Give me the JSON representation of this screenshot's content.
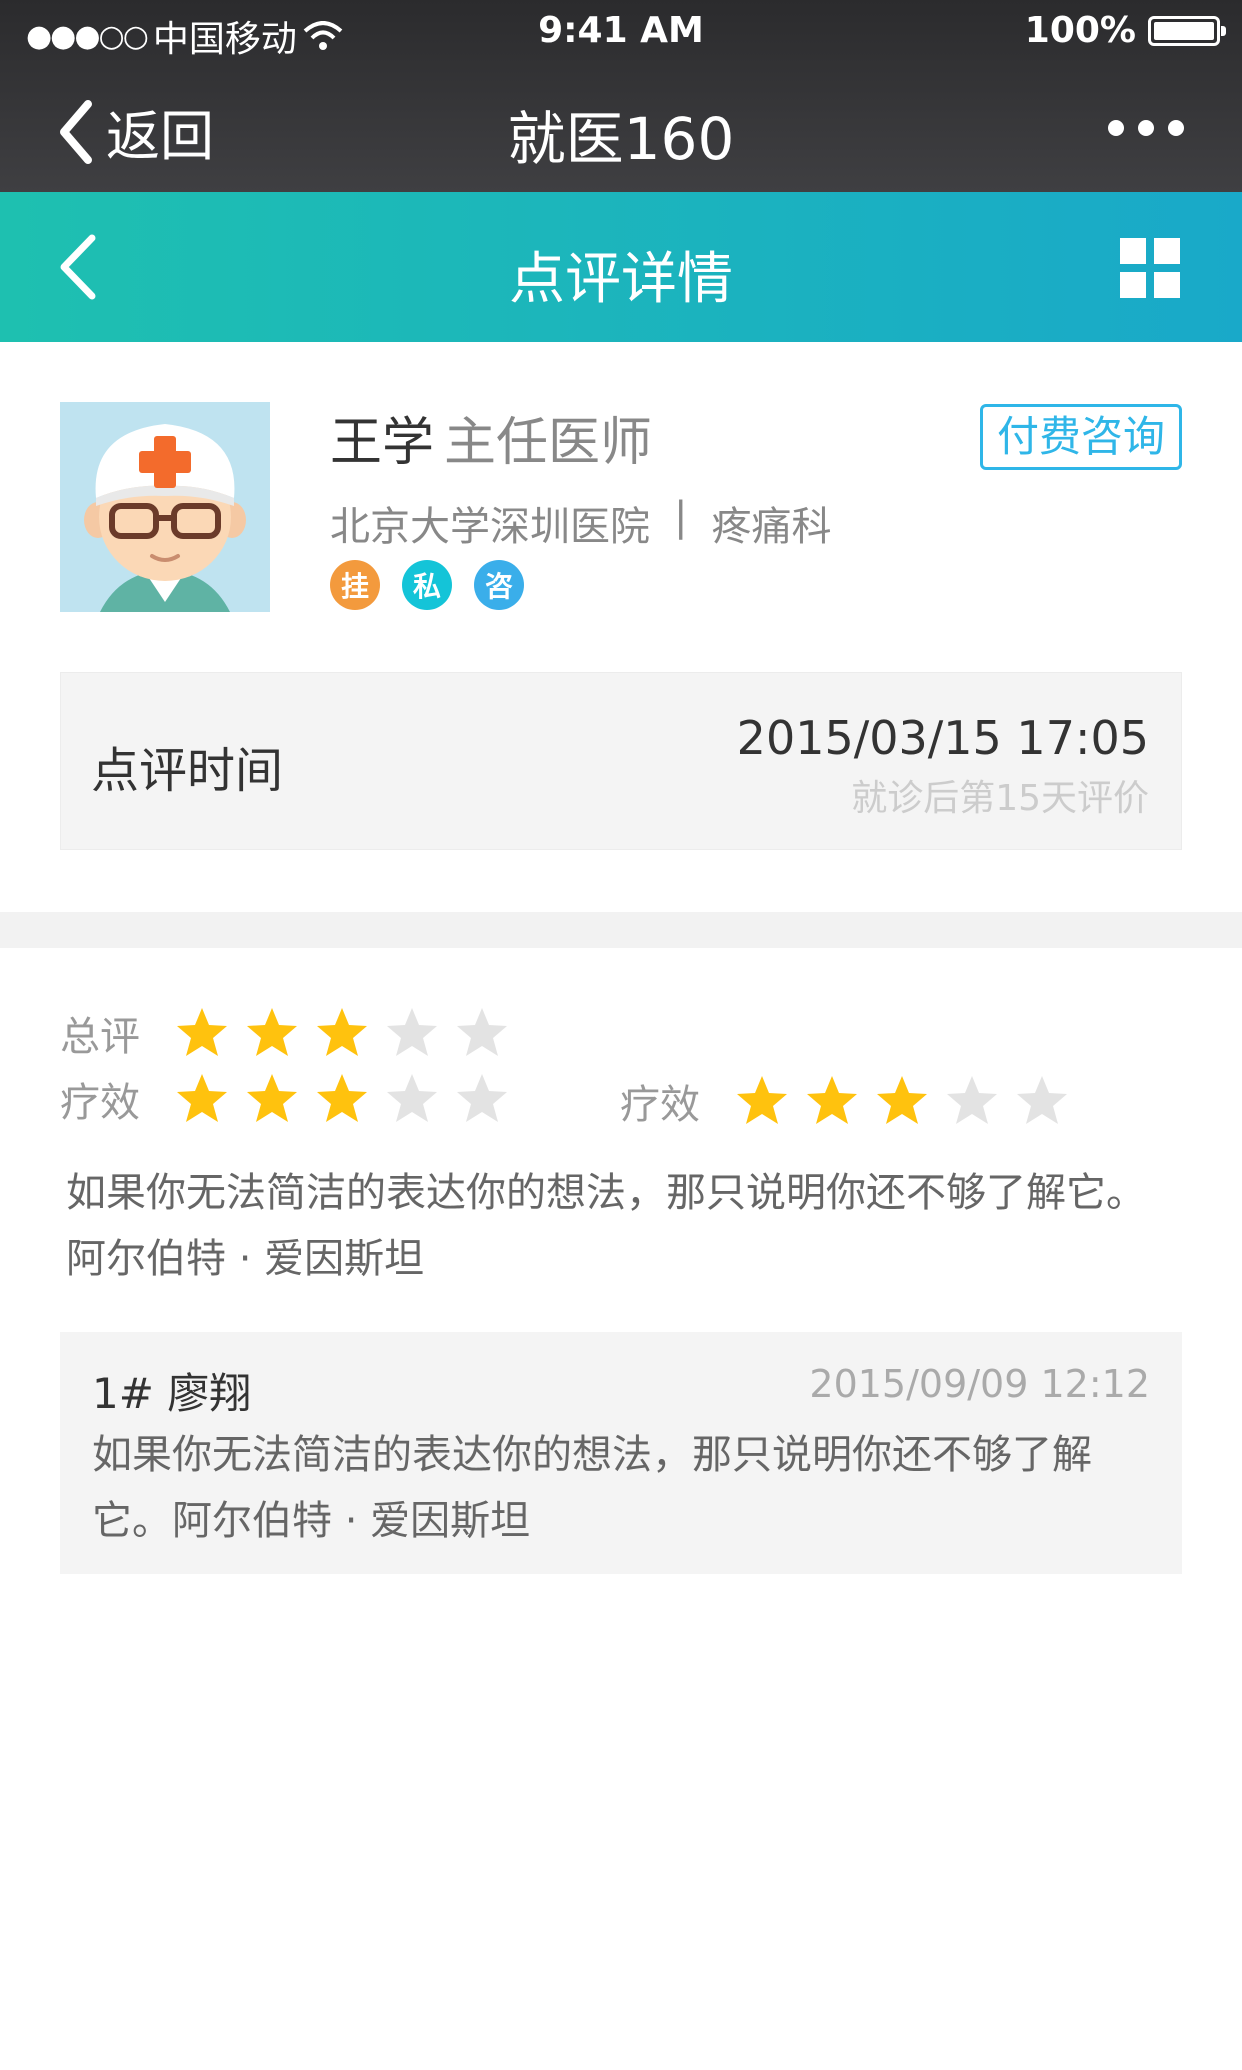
{
  "status": {
    "signal": "●●●○○",
    "carrier": "中国移动",
    "time": "9:41 AM",
    "battery": "100%"
  },
  "browser_nav": {
    "back_label": "返回",
    "title": "就医160"
  },
  "header": {
    "title": "点评详情"
  },
  "doctor": {
    "name": "王学",
    "rank": "主任医师",
    "hospital": "北京大学深圳医院",
    "separator": "|",
    "department": "疼痛科",
    "consult_button": "付费咨询",
    "tags": [
      {
        "label": "挂",
        "color": "#f39a3d"
      },
      {
        "label": "私",
        "color": "#14c4d8"
      },
      {
        "label": "咨",
        "color": "#3aaeea"
      }
    ]
  },
  "review_time": {
    "label": "点评时间",
    "datetime": "2015/03/15  17:05",
    "note": "就诊后第15天评价"
  },
  "ratings": [
    {
      "label": "总评",
      "stars": 3,
      "max": 5
    },
    {
      "label": "疗效",
      "stars": 3,
      "max": 5
    },
    {
      "label": "疗效",
      "stars": 3,
      "max": 5
    }
  ],
  "review": {
    "line1": "如果你无法简洁的表达你的想法，那只说明你还不够了解它。",
    "line2": "阿尔伯特 · 爱因斯坦"
  },
  "reply": {
    "author": "1#  廖翔",
    "date": "2015/09/09 12:12",
    "text": "如果你无法简洁的表达你的想法，那只说明你还不够了解它。阿尔伯特 · 爱因斯坦"
  },
  "colors": {
    "teal_start": "#1ec0b0",
    "teal_end": "#19a9c9",
    "star_on": "#ffc20e",
    "star_off": "#e3e3e3",
    "accent_blue": "#2fb6e8"
  }
}
